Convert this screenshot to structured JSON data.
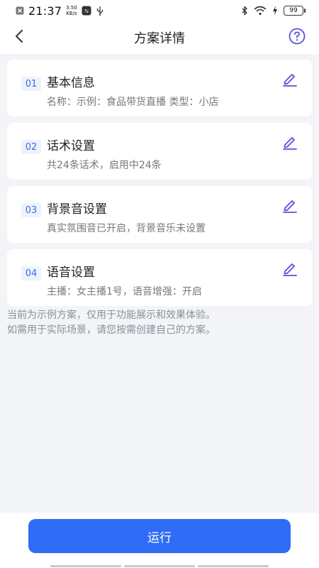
{
  "status_bar": {
    "time": "21:37",
    "speed_value": "3.50",
    "speed_unit": "KB/s",
    "battery": "99"
  },
  "header": {
    "title": "方案详情"
  },
  "cards": [
    {
      "num": "01",
      "title": "基本信息",
      "desc": "名称：示例：食品带货直播    类型：小店"
    },
    {
      "num": "02",
      "title": "话术设置",
      "desc": "共24条话术，启用中24条"
    },
    {
      "num": "03",
      "title": "背景音设置",
      "desc": "真实氛围音已开启，背景音乐未设置"
    },
    {
      "num": "04",
      "title": "语音设置",
      "desc": "主播：女主播1号，语音增强：开启"
    }
  ],
  "notice": {
    "line1": "当前为示例方案，仅用于功能展示和效果体验。",
    "line2": "如需用于实际场景，请您按需创建自己的方案。"
  },
  "footer": {
    "run_label": "运行"
  },
  "colors": {
    "accent": "#2f6cf6",
    "icon_purple": "#5b4fe0",
    "background": "#f2f4f8"
  }
}
